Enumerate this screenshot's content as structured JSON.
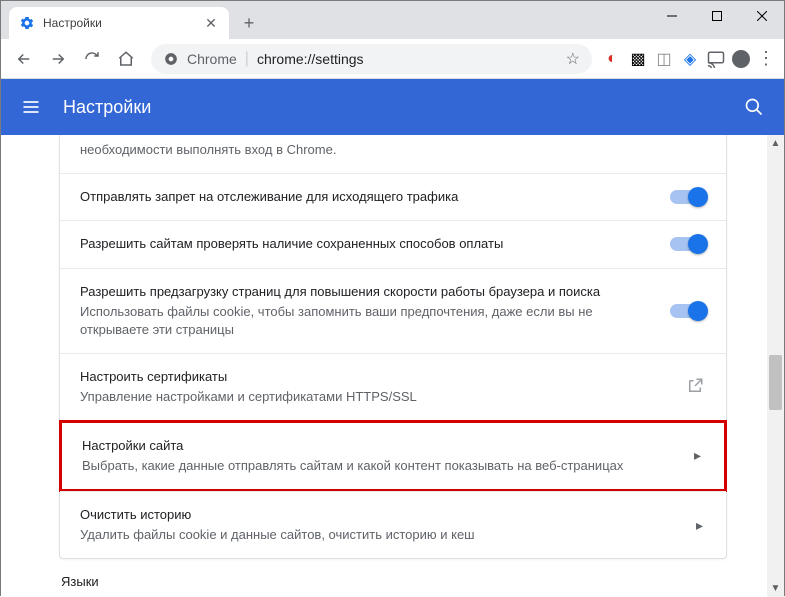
{
  "window": {
    "tab_title": "Настройки"
  },
  "omnibox": {
    "prefix": "Chrome",
    "url": "chrome://settings"
  },
  "header": {
    "title": "Настройки"
  },
  "rows": {
    "partial": {
      "sub": "необходимости выполнять вход в Chrome."
    },
    "dnt": {
      "title": "Отправлять запрет на отслеживание для исходящего трафика"
    },
    "payment": {
      "title": "Разрешить сайтам проверять наличие сохраненных способов оплаты"
    },
    "preload": {
      "title": "Разрешить предзагрузку страниц для повышения скорости работы браузера и поиска",
      "sub": "Использовать файлы cookie, чтобы запомнить ваши предпочтения, даже если вы не открываете эти страницы"
    },
    "certs": {
      "title": "Настроить сертификаты",
      "sub": "Управление настройками и сертификатами HTTPS/SSL"
    },
    "site": {
      "title": "Настройки сайта",
      "sub": "Выбрать, какие данные отправлять сайтам и какой контент показывать на веб-страницах"
    },
    "clear": {
      "title": "Очистить историю",
      "sub": "Удалить файлы cookie и данные сайтов, очистить историю и кеш"
    }
  },
  "section": {
    "languages": "Языки"
  }
}
